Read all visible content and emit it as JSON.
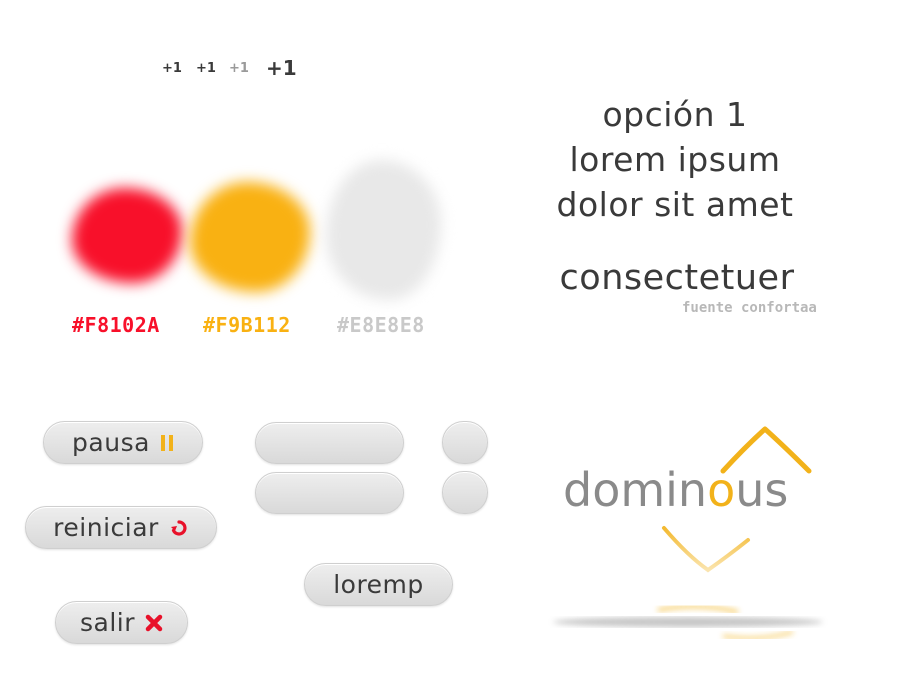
{
  "plus_one": {
    "label": "+1"
  },
  "swatches": [
    {
      "hex_label": "#F8102A",
      "color": "#F8102A"
    },
    {
      "hex_label": "#F9B112",
      "color": "#F9B112"
    },
    {
      "hex_label": "#E8E8E8",
      "color": "#E8E8E8"
    }
  ],
  "typography": {
    "lines": [
      "opción 1",
      "lorem ipsum",
      "dolor sit amet"
    ],
    "large": "consectetuer",
    "caption": "fuente confortaa"
  },
  "buttons": {
    "pausa": "pausa",
    "reiniciar": "reiniciar",
    "salir": "salir",
    "loremp": "loremp"
  },
  "logo": {
    "text_before": "domin",
    "text_accent": "o",
    "text_after": "us",
    "accent_color": "#F2B21A",
    "text_color": "#8A8A8A"
  },
  "icons": {
    "pause": "pause-icon",
    "restart": "restart-icon",
    "close": "close-icon"
  }
}
